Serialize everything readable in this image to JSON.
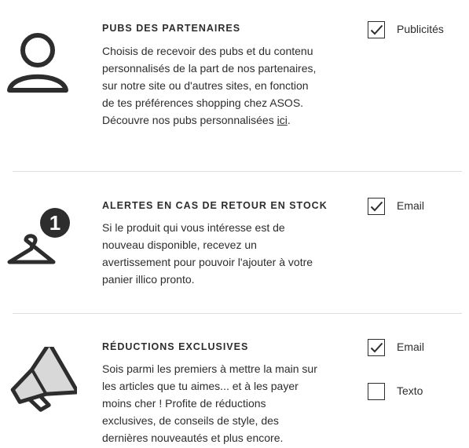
{
  "sections": [
    {
      "title": "PUBS DES PARTENAIRES",
      "description_before_link": "Choisis de recevoir des pubs et du contenu personnalisés de la part de nos partenaires, sur notre site ou d'autres sites, en fonction de tes préférences shopping chez ASOS. Découvre nos pubs personnalisées ",
      "link_text": "ici",
      "description_after_link": ".",
      "icon": "person-icon",
      "options": [
        {
          "label": "Publicités",
          "checked": true
        }
      ]
    },
    {
      "title": "ALERTES EN CAS DE RETOUR EN STOCK",
      "description": "Si le produit qui vous intéresse est de nouveau disponible, recevez un avertissement pour pouvoir l'ajouter à votre panier illico pronto.",
      "icon": "hanger-icon",
      "badge": "1",
      "options": [
        {
          "label": "Email",
          "checked": true
        }
      ]
    },
    {
      "title": "RÉDUCTIONS EXCLUSIVES",
      "description": "Sois parmi les premiers à mettre la main sur les articles que tu aimes... et à les payer moins cher ! Profite de réductions exclusives, de conseils de style, des dernières nouveautés et plus encore.",
      "icon": "megaphone-icon",
      "options": [
        {
          "label": "Email",
          "checked": true
        },
        {
          "label": "Texto",
          "checked": false
        }
      ]
    }
  ]
}
